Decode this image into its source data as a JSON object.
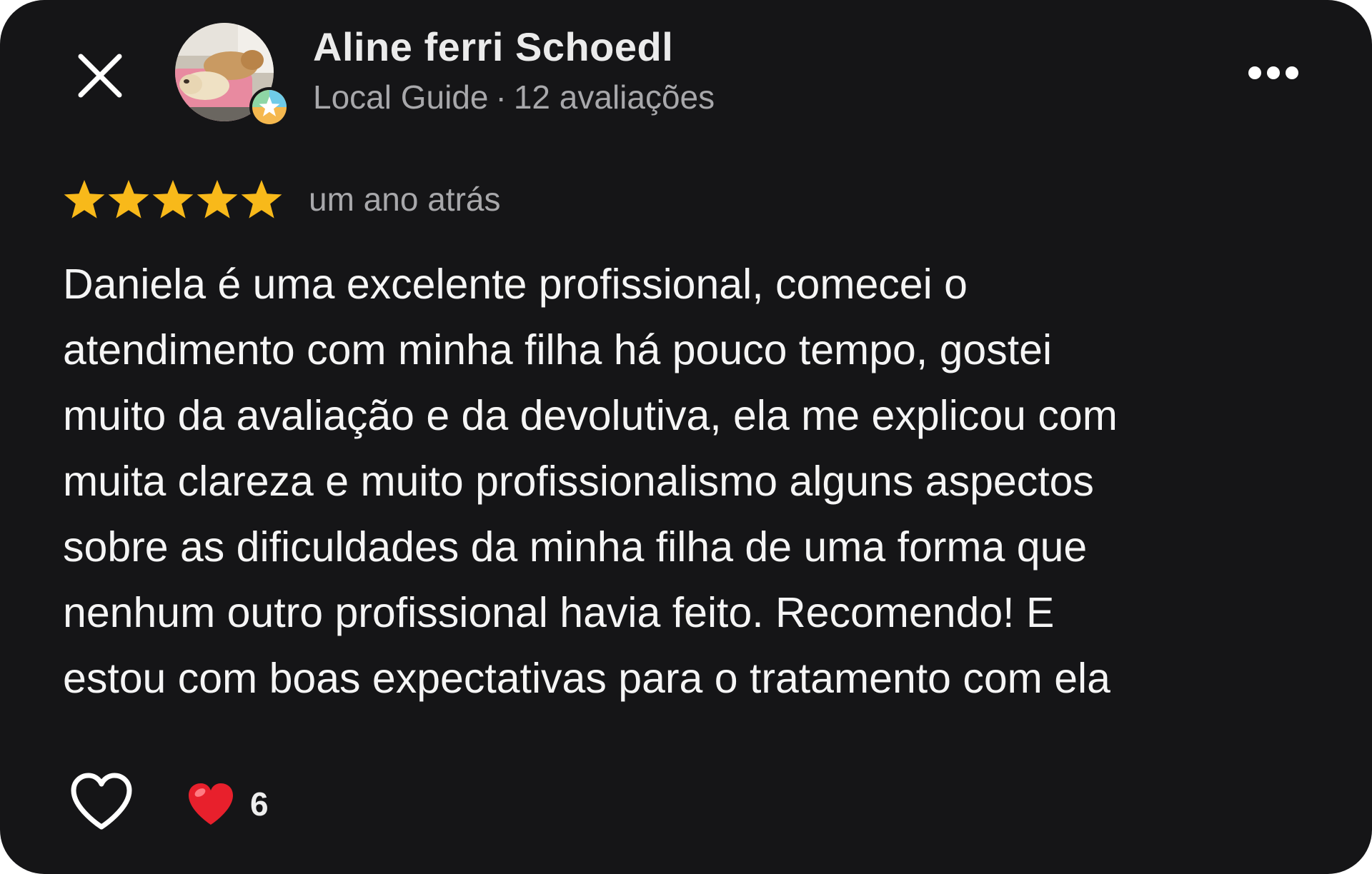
{
  "reviewer": {
    "name": "Aline ferri Schoedl",
    "badge": "Local Guide",
    "separator": "·",
    "reviews_count": "12 avaliações"
  },
  "rating": {
    "stars": 5,
    "max_stars": 5,
    "date": "um ano atrás"
  },
  "review": {
    "lines": [
      "Daniela é uma excelente profissional, comecei o",
      "atendimento com minha filha há pouco tempo, gostei",
      "muito da avaliação e da devolutiva, ela me explicou com",
      "muita clareza e muito profissionalismo alguns aspectos",
      "sobre as dificuldades da minha filha de uma forma que",
      "nenhum outro profissional havia feito. Recomendo! E",
      "estou com boas expectativas para o tratamento com ela"
    ]
  },
  "reactions": {
    "heart_count": "6"
  },
  "icons": {
    "close": "close-icon",
    "more": "more-horizontal-icon",
    "star": "star-icon",
    "like": "heart-outline-icon",
    "reaction": "red-heart-icon",
    "guide_badge": "local-guide-star-icon"
  },
  "colors": {
    "background": "#151517",
    "text_primary": "#f5f5f5",
    "text_secondary": "#a8a8ab",
    "star": "#f8b91a",
    "reaction_heart": "#e8202c"
  }
}
